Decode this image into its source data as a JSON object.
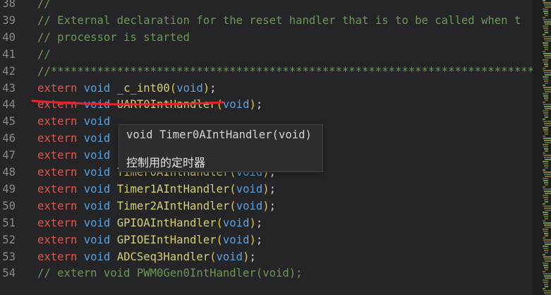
{
  "editor": {
    "lines": [
      {
        "number": "38",
        "tokens": [
          {
            "t": "//",
            "c": "comment"
          }
        ]
      },
      {
        "number": "39",
        "tokens": [
          {
            "t": "// External declaration for the reset handler that is to be called when t",
            "c": "comment"
          }
        ]
      },
      {
        "number": "40",
        "tokens": [
          {
            "t": "// processor is started",
            "c": "comment"
          }
        ]
      },
      {
        "number": "41",
        "tokens": [
          {
            "t": "//",
            "c": "comment"
          }
        ]
      },
      {
        "number": "42",
        "tokens": [
          {
            "t": "//*******************************************************************************",
            "c": "comment"
          }
        ]
      },
      {
        "number": "43",
        "tokens": [
          {
            "t": "extern",
            "c": "keyword"
          },
          {
            "t": " ",
            "c": "punct"
          },
          {
            "t": "void",
            "c": "type"
          },
          {
            "t": " ",
            "c": "punct"
          },
          {
            "t": "_c_int00",
            "c": "func"
          },
          {
            "t": "(",
            "c": "paren"
          },
          {
            "t": "void",
            "c": "type"
          },
          {
            "t": ")",
            "c": "paren"
          },
          {
            "t": ";",
            "c": "punct"
          }
        ]
      },
      {
        "number": "44",
        "tokens": [
          {
            "t": "extern",
            "c": "keyword"
          },
          {
            "t": " ",
            "c": "punct"
          },
          {
            "t": "void",
            "c": "type"
          },
          {
            "t": " ",
            "c": "punct"
          },
          {
            "t": "UART0IntHandler",
            "c": "func"
          },
          {
            "t": "(",
            "c": "paren"
          },
          {
            "t": "void",
            "c": "type"
          },
          {
            "t": ")",
            "c": "paren"
          },
          {
            "t": ";",
            "c": "punct"
          }
        ]
      },
      {
        "number": "45",
        "tokens": [
          {
            "t": "extern",
            "c": "keyword"
          },
          {
            "t": " ",
            "c": "punct"
          },
          {
            "t": "void",
            "c": "type"
          }
        ]
      },
      {
        "number": "46",
        "tokens": [
          {
            "t": "extern",
            "c": "keyword"
          },
          {
            "t": " ",
            "c": "punct"
          },
          {
            "t": "void",
            "c": "type"
          }
        ]
      },
      {
        "number": "47",
        "tokens": [
          {
            "t": "extern",
            "c": "keyword"
          },
          {
            "t": " ",
            "c": "punct"
          },
          {
            "t": "void",
            "c": "type"
          }
        ]
      },
      {
        "number": "48",
        "tokens": [
          {
            "t": "extern",
            "c": "keyword"
          },
          {
            "t": " ",
            "c": "punct"
          },
          {
            "t": "void",
            "c": "type"
          },
          {
            "t": " ",
            "c": "punct"
          },
          {
            "t": "Timer0AIntHandler",
            "c": "func"
          },
          {
            "t": "(",
            "c": "paren"
          },
          {
            "t": "void",
            "c": "type"
          },
          {
            "t": ")",
            "c": "paren"
          },
          {
            "t": ";",
            "c": "punct"
          }
        ]
      },
      {
        "number": "49",
        "tokens": [
          {
            "t": "extern",
            "c": "keyword"
          },
          {
            "t": " ",
            "c": "punct"
          },
          {
            "t": "void",
            "c": "type"
          },
          {
            "t": " ",
            "c": "punct"
          },
          {
            "t": "Timer1AIntHandler",
            "c": "func"
          },
          {
            "t": "(",
            "c": "paren"
          },
          {
            "t": "void",
            "c": "type"
          },
          {
            "t": ")",
            "c": "paren"
          },
          {
            "t": ";",
            "c": "punct"
          }
        ]
      },
      {
        "number": "50",
        "tokens": [
          {
            "t": "extern",
            "c": "keyword"
          },
          {
            "t": " ",
            "c": "punct"
          },
          {
            "t": "void",
            "c": "type"
          },
          {
            "t": " ",
            "c": "punct"
          },
          {
            "t": "Timer2AIntHandler",
            "c": "func"
          },
          {
            "t": "(",
            "c": "paren"
          },
          {
            "t": "void",
            "c": "type"
          },
          {
            "t": ")",
            "c": "paren"
          },
          {
            "t": ";",
            "c": "punct"
          }
        ]
      },
      {
        "number": "51",
        "tokens": [
          {
            "t": "extern",
            "c": "keyword"
          },
          {
            "t": " ",
            "c": "punct"
          },
          {
            "t": "void",
            "c": "type"
          },
          {
            "t": " ",
            "c": "punct"
          },
          {
            "t": "GPIOAIntHandler",
            "c": "func"
          },
          {
            "t": "(",
            "c": "paren"
          },
          {
            "t": "void",
            "c": "type"
          },
          {
            "t": ")",
            "c": "paren"
          },
          {
            "t": ";",
            "c": "punct"
          }
        ]
      },
      {
        "number": "52",
        "tokens": [
          {
            "t": "extern",
            "c": "keyword"
          },
          {
            "t": " ",
            "c": "punct"
          },
          {
            "t": "void",
            "c": "type"
          },
          {
            "t": " ",
            "c": "punct"
          },
          {
            "t": "GPIOEIntHandler",
            "c": "func"
          },
          {
            "t": "(",
            "c": "paren"
          },
          {
            "t": "void",
            "c": "type"
          },
          {
            "t": ")",
            "c": "paren"
          },
          {
            "t": ";",
            "c": "punct"
          }
        ]
      },
      {
        "number": "53",
        "tokens": [
          {
            "t": "extern",
            "c": "keyword"
          },
          {
            "t": " ",
            "c": "punct"
          },
          {
            "t": "void",
            "c": "type"
          },
          {
            "t": " ",
            "c": "punct"
          },
          {
            "t": "ADCSeq3Handler",
            "c": "func"
          },
          {
            "t": "(",
            "c": "paren"
          },
          {
            "t": "void",
            "c": "type"
          },
          {
            "t": ")",
            "c": "paren"
          },
          {
            "t": ";",
            "c": "punct"
          }
        ]
      },
      {
        "number": "54",
        "tokens": [
          {
            "t": "// extern void PWM0Gen0IntHandler(void);",
            "c": "comment"
          }
        ]
      }
    ]
  },
  "tooltip": {
    "signature": "void Timer0AIntHandler(void)",
    "doc": "控制用的定时器"
  },
  "colors": {
    "background": "#252527",
    "comment": "#6a9955",
    "keyword": "#e0584e",
    "type": "#5aa3e0",
    "function": "#d2cf76",
    "annotation": "#e8212b"
  }
}
